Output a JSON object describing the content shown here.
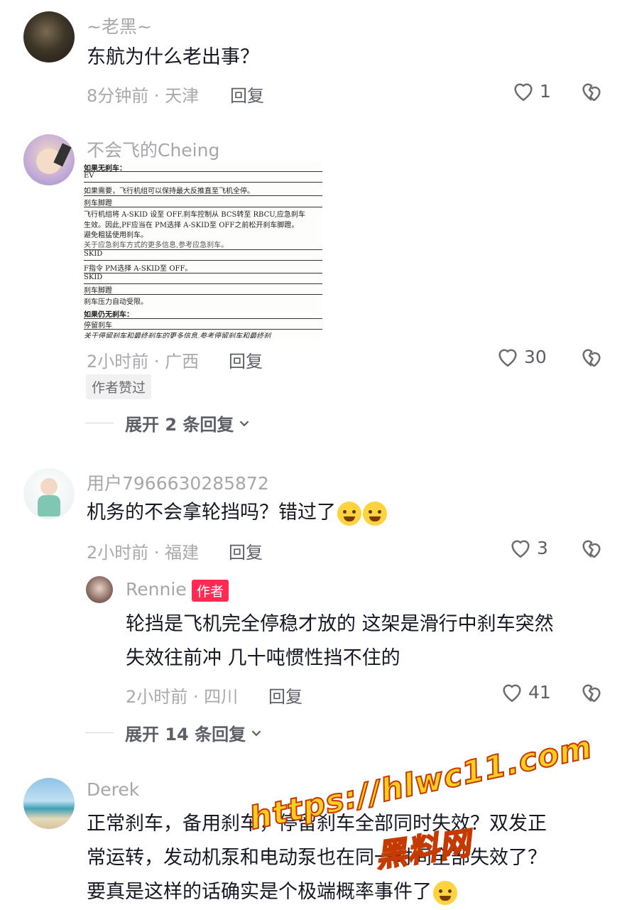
{
  "comments": [
    {
      "username": "~老黑~",
      "text": "东航为什么老出事？",
      "time_location": "8分钟前 · 天津",
      "reply_label": "回复",
      "likes": "1"
    },
    {
      "username": "不会飞的Cheing",
      "image": {
        "lines": [
          "如果无刹车：",
          "EV",
          "如果需要，飞行机组可以保持最大反推直至飞机全停。",
          "刹车脚蹬",
          "飞行机组将 A-SKID 设至 OFF.刹车控制从 BCS转至 RBCU,应急刹车",
          "生效。因此,PF应当在 PM选择 A-SKID至 OFF之前松开刹车脚蹬。",
          "避免粗猛使用刹车。",
          "关于应急刹车方式的更多信息,参考应急刹车。",
          "SKID",
          "F指令 PM选择 A-SKID至 OFF。",
          "SKID",
          "刹车脚蹬",
          "刹车压力自动受限。",
          "如果仍无刹车：",
          "停留刹车",
          "关于停留刹车和最终刹车的更多信息,参考停留刹车和最终刹"
        ]
      },
      "time_location": "2小时前 · 广西",
      "reply_label": "回复",
      "likes": "30",
      "author_liked_tag": "作者赞过",
      "expand_label": "展开 2 条回复"
    },
    {
      "username": "用户7966630285872",
      "text": "机务的不会拿轮挡吗？错过了",
      "time_location": "2小时前 · 福建",
      "reply_label": "回复",
      "likes": "3",
      "replies": [
        {
          "username": "Rennie",
          "author_tag": "作者",
          "text_line1": "轮挡是飞机完全停稳才放的 这架是滑行中刹车突然",
          "text_line2": "失效往前冲 几十吨惯性挡不住的",
          "time_location": "2小时前 · 四川",
          "reply_label": "回复",
          "likes": "41"
        }
      ],
      "expand_label": "展开 14 条回复"
    },
    {
      "username": "Derek",
      "text_line1": "正常刹车，备用刹车，停留刹车全部同时失效？双发正",
      "text_line2": "常运转，发动机泵和电动泵也在同一时间全部失效了？",
      "text_line3": "要真是这样的话确实是个极端概率事件了"
    }
  ],
  "watermark": {
    "url": "https://hlwc11.com",
    "name": "黑料网"
  },
  "colors": {
    "author_tag": "#fe2c55",
    "text": "#161823",
    "meta": "#a8a9ad"
  }
}
